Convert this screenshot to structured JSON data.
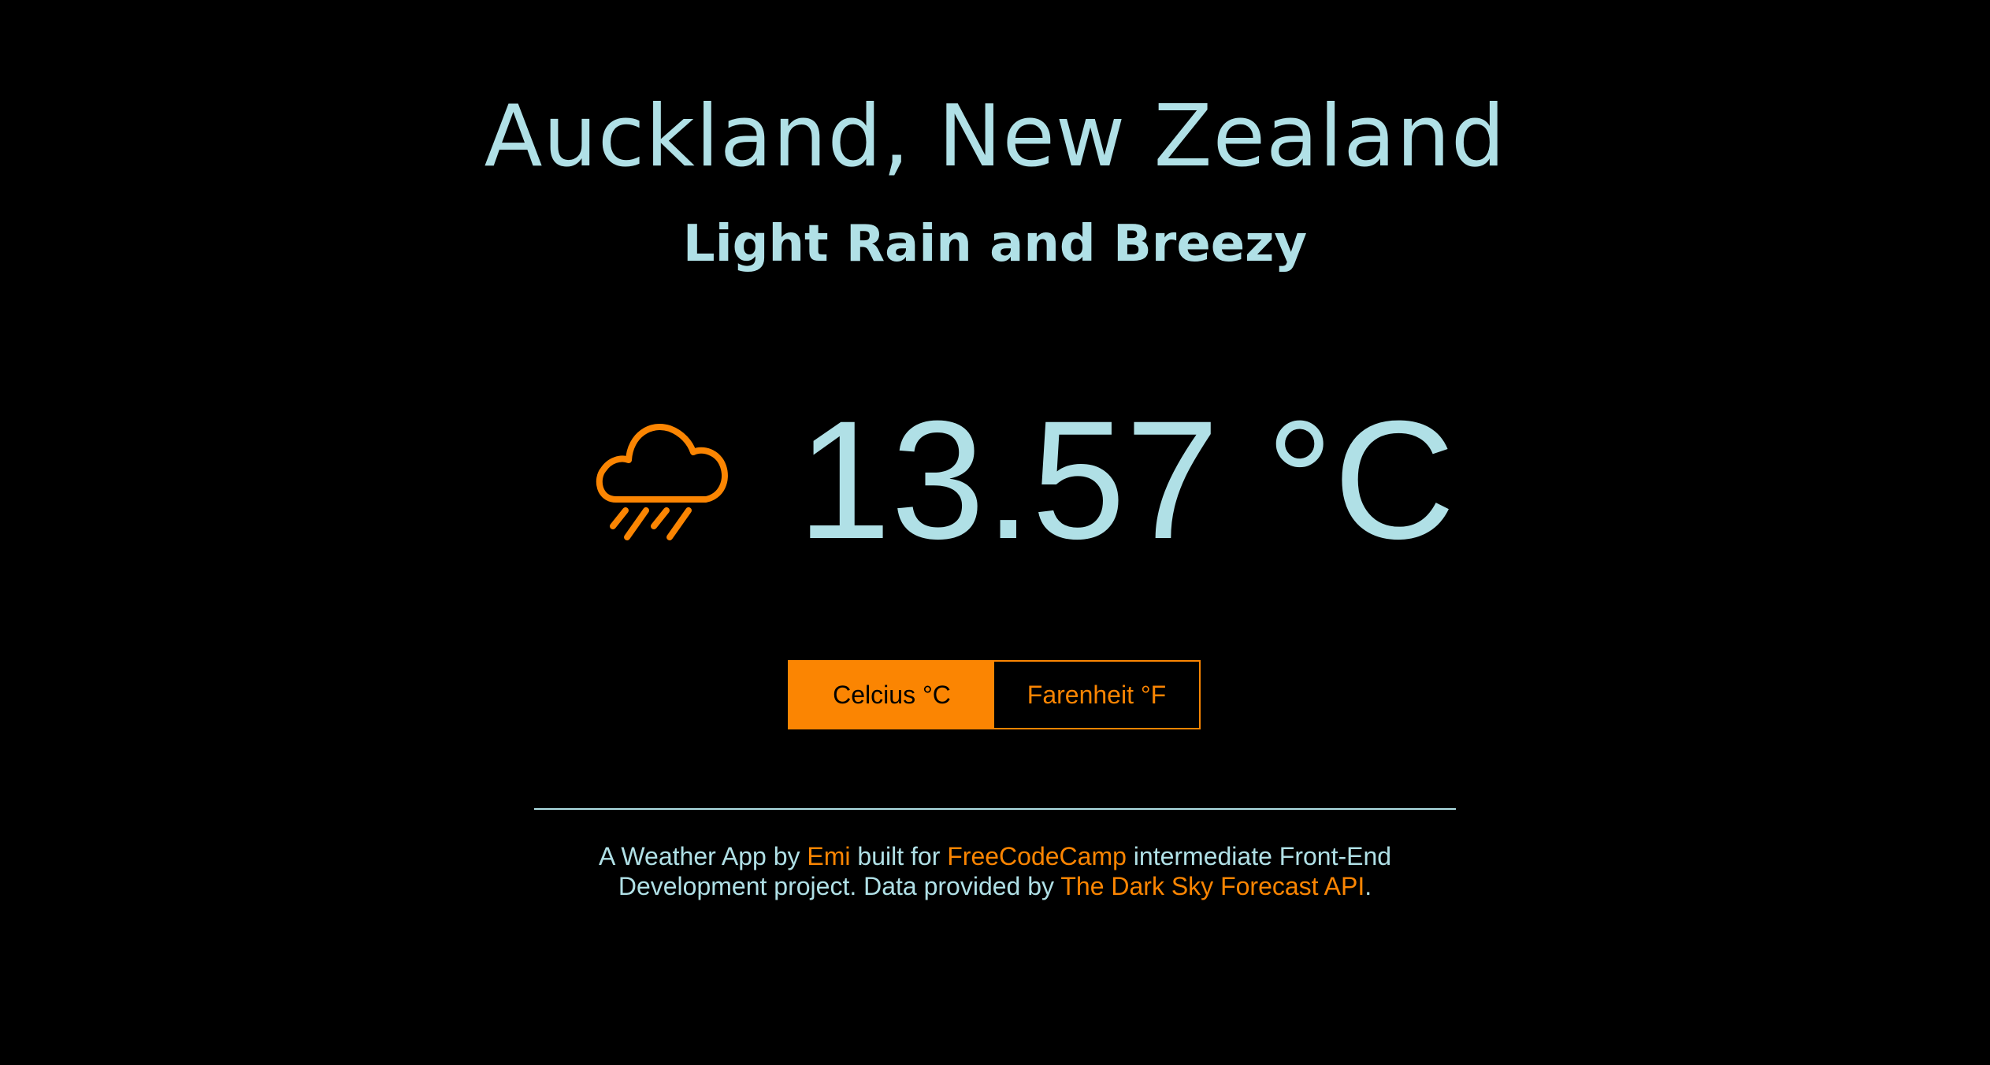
{
  "location": {
    "title": "Auckland, New Zealand",
    "summary": "Light Rain and Breezy"
  },
  "current": {
    "icon": "rain-icon",
    "temperature": "13.57 °C"
  },
  "unit_toggle": {
    "celsius_label": "Celcius °C",
    "fahrenheit_label": "Farenheit °F",
    "selected": "celsius"
  },
  "footer": {
    "text_1": "A Weather App by ",
    "author_link": "Emi",
    "text_2": " built for ",
    "fcc_link": "FreeCodeCamp",
    "text_3": " intermediate Front-End Development project. Data provided by ",
    "api_link": "The Dark Sky Forecast API",
    "text_4": "."
  },
  "colors": {
    "background": "#000000",
    "text": "#b0e0e6",
    "accent": "#fb8502"
  }
}
